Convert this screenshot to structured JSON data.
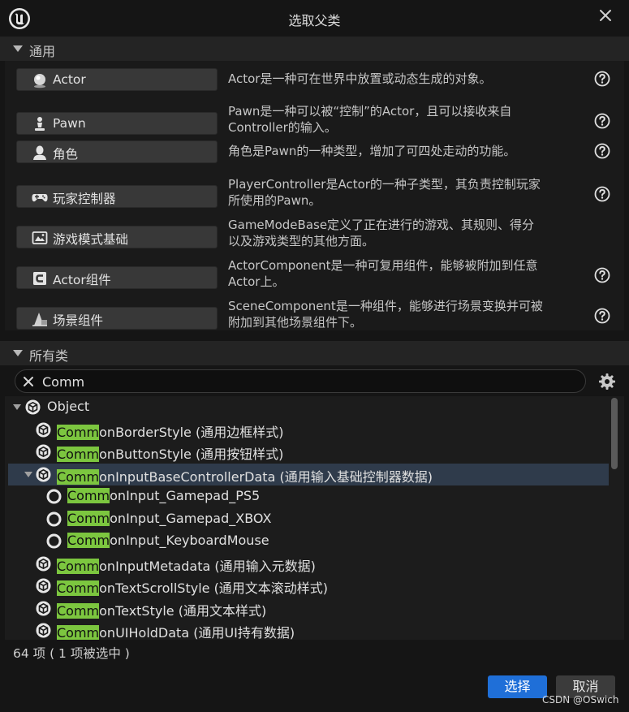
{
  "window": {
    "title": "选取父类"
  },
  "common_section": {
    "header": "通用",
    "items": [
      {
        "label": "Actor",
        "icon": "actor-sphere-icon",
        "desc": [
          "Actor是一种可在世界中放置或动态生成的对象。"
        ],
        "help": true
      },
      {
        "label": "Pawn",
        "icon": "pawn-figure-icon",
        "desc": [
          "Pawn是一种可以被“控制”的Actor，且可以接收来自",
          "Controller的输入。"
        ],
        "help": true
      },
      {
        "label": "角色",
        "icon": "character-bust-icon",
        "desc": [
          "角色是Pawn的一种类型，增加了可四处走动的功能。"
        ],
        "help": true
      },
      {
        "label": "玩家控制器",
        "icon": "gamepad-icon",
        "desc": [
          "PlayerController是Actor的一种子类型，其负责控制玩家",
          "所使用的Pawn。"
        ],
        "help": true
      },
      {
        "label": "游戏模式基础",
        "icon": "game-mode-icon",
        "desc": [
          "GameModeBase定义了正在进行的游戏、其规则、得分",
          "以及游戏类型的其他方面。"
        ],
        "help": false
      },
      {
        "label": "Actor组件",
        "icon": "actor-component-icon",
        "desc": [
          "ActorComponent是一种可复用组件，能够被附加到任意",
          "Actor上。"
        ],
        "help": true
      },
      {
        "label": "场景组件",
        "icon": "scene-component-icon",
        "desc": [
          "SceneComponent是一种组件，能够进行场景变换并可被",
          "附加到其他场景组件下。"
        ],
        "help": true
      }
    ]
  },
  "all_classes_section": {
    "header": "所有类",
    "search": {
      "value": "Comm"
    },
    "highlight_color": "#7cc63f",
    "tree": [
      {
        "hl": "",
        "rest": "Object",
        "level": 0,
        "expanded": true,
        "selected": false,
        "icon": "class-cube-icon"
      },
      {
        "hl": "Comm",
        "rest": "onBorderStyle (通用边框样式)",
        "level": 1,
        "expanded": false,
        "selected": false,
        "icon": "class-cube-icon"
      },
      {
        "hl": "Comm",
        "rest": "onButtonStyle (通用按钮样式)",
        "level": 1,
        "expanded": false,
        "selected": false,
        "icon": "class-cube-icon"
      },
      {
        "hl": "Comm",
        "rest": "onInputBaseControllerData (通用输入基础控制器数据)",
        "level": 1,
        "expanded": true,
        "selected": true,
        "icon": "class-cube-icon"
      },
      {
        "hl": "Comm",
        "rest": "onInput_Gamepad_PS5",
        "level": 2,
        "expanded": false,
        "selected": false,
        "icon": "blueprint-circle-icon"
      },
      {
        "hl": "Comm",
        "rest": "onInput_Gamepad_XBOX",
        "level": 2,
        "expanded": false,
        "selected": false,
        "icon": "blueprint-circle-icon"
      },
      {
        "hl": "Comm",
        "rest": "onInput_KeyboardMouse",
        "level": 2,
        "expanded": false,
        "selected": false,
        "icon": "blueprint-circle-icon"
      },
      {
        "hl": "Comm",
        "rest": "onInputMetadata (通用输入元数据)",
        "level": 1,
        "expanded": false,
        "selected": false,
        "icon": "class-cube-icon"
      },
      {
        "hl": "Comm",
        "rest": "onTextScrollStyle (通用文本滚动样式)",
        "level": 1,
        "expanded": false,
        "selected": false,
        "icon": "class-cube-icon"
      },
      {
        "hl": "Comm",
        "rest": "onTextStyle (通用文本样式)",
        "level": 1,
        "expanded": false,
        "selected": false,
        "icon": "class-cube-icon"
      },
      {
        "hl": "Comm",
        "rest": "onUIHoldData (通用UI持有数据)",
        "level": 1,
        "expanded": false,
        "selected": false,
        "icon": "class-cube-icon"
      }
    ],
    "status": "64 项 ( 1 项被选中 )"
  },
  "buttons": {
    "select": "选择",
    "cancel": "取消"
  },
  "watermark": "CSDN @OSwich"
}
